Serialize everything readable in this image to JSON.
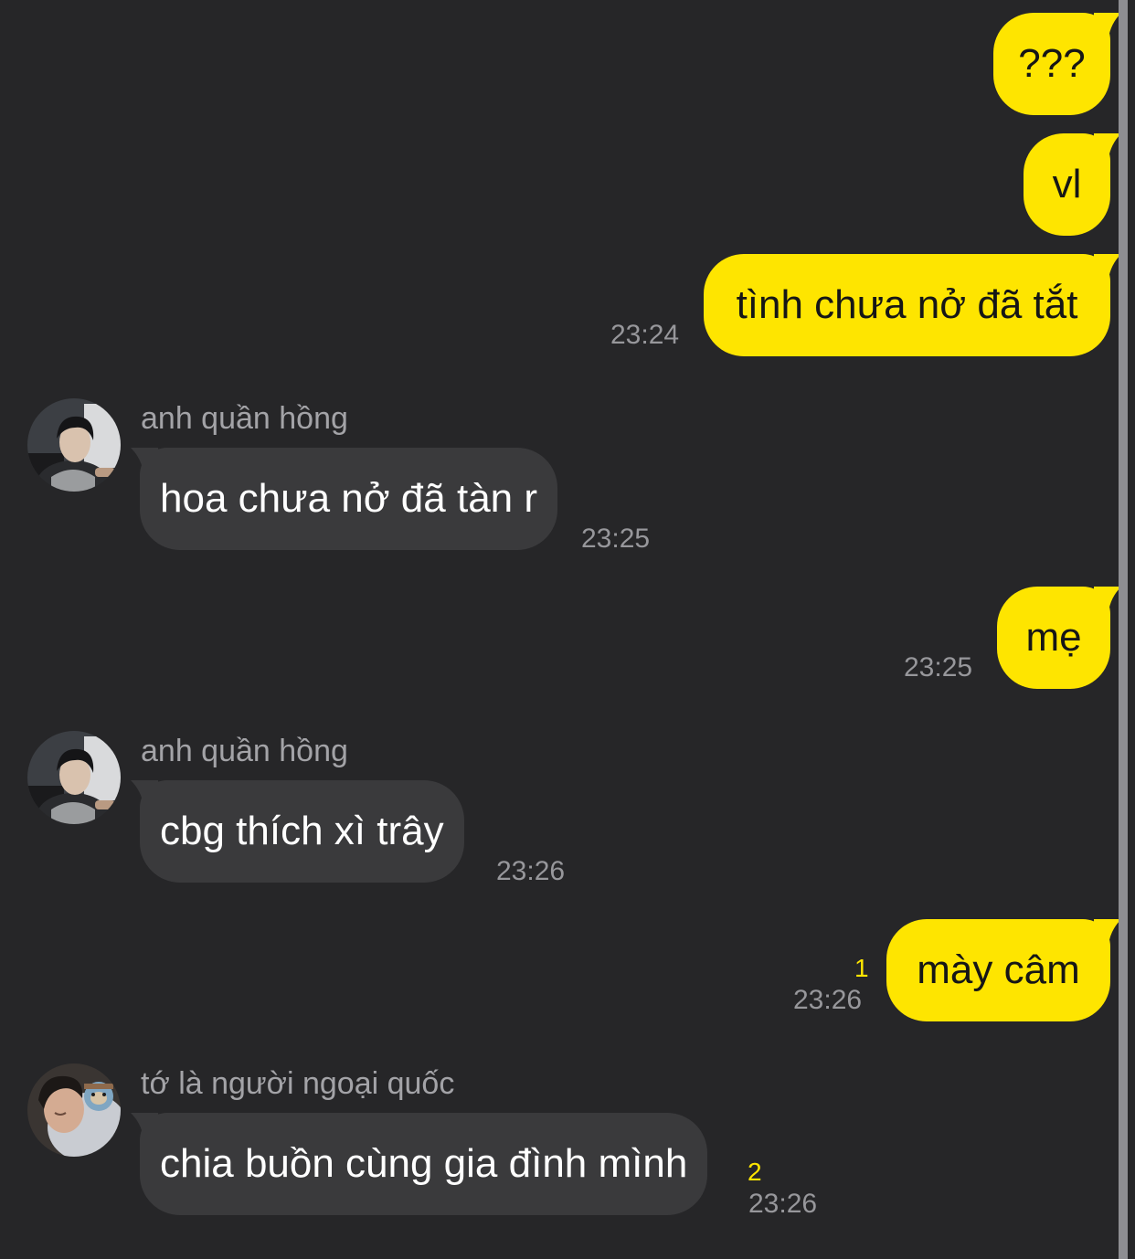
{
  "messages": [
    {
      "kind": "sent",
      "text": "???"
    },
    {
      "kind": "sent",
      "text": "vl"
    },
    {
      "kind": "sent",
      "text": "tình chưa nở đã tắt",
      "time": "23:24"
    },
    {
      "kind": "received",
      "sender": "anh quần hồng",
      "avatar": "person-in-car-photo",
      "text": "hoa chưa nở đã tàn r",
      "time": "23:25"
    },
    {
      "kind": "sent",
      "text": "mẹ",
      "time": "23:25"
    },
    {
      "kind": "received",
      "sender": "anh quần hồng",
      "avatar": "person-in-car-photo",
      "text": "cbg thích xì trây",
      "time": "23:26"
    },
    {
      "kind": "sent",
      "text": "mày câm",
      "time": "23:26",
      "unread": "1"
    },
    {
      "kind": "received",
      "sender": "tớ là người ngoại quốc",
      "avatar": "sleeping-person-with-plush-photo",
      "text": "chia buồn cùng gia đình mình",
      "time": "23:26",
      "unread": "2"
    }
  ],
  "colors": {
    "background": "#262628",
    "sent_bubble": "#fee500",
    "received_bubble": "#3a3a3c",
    "unread_count": "#fee500",
    "timestamp": "#97979b"
  }
}
